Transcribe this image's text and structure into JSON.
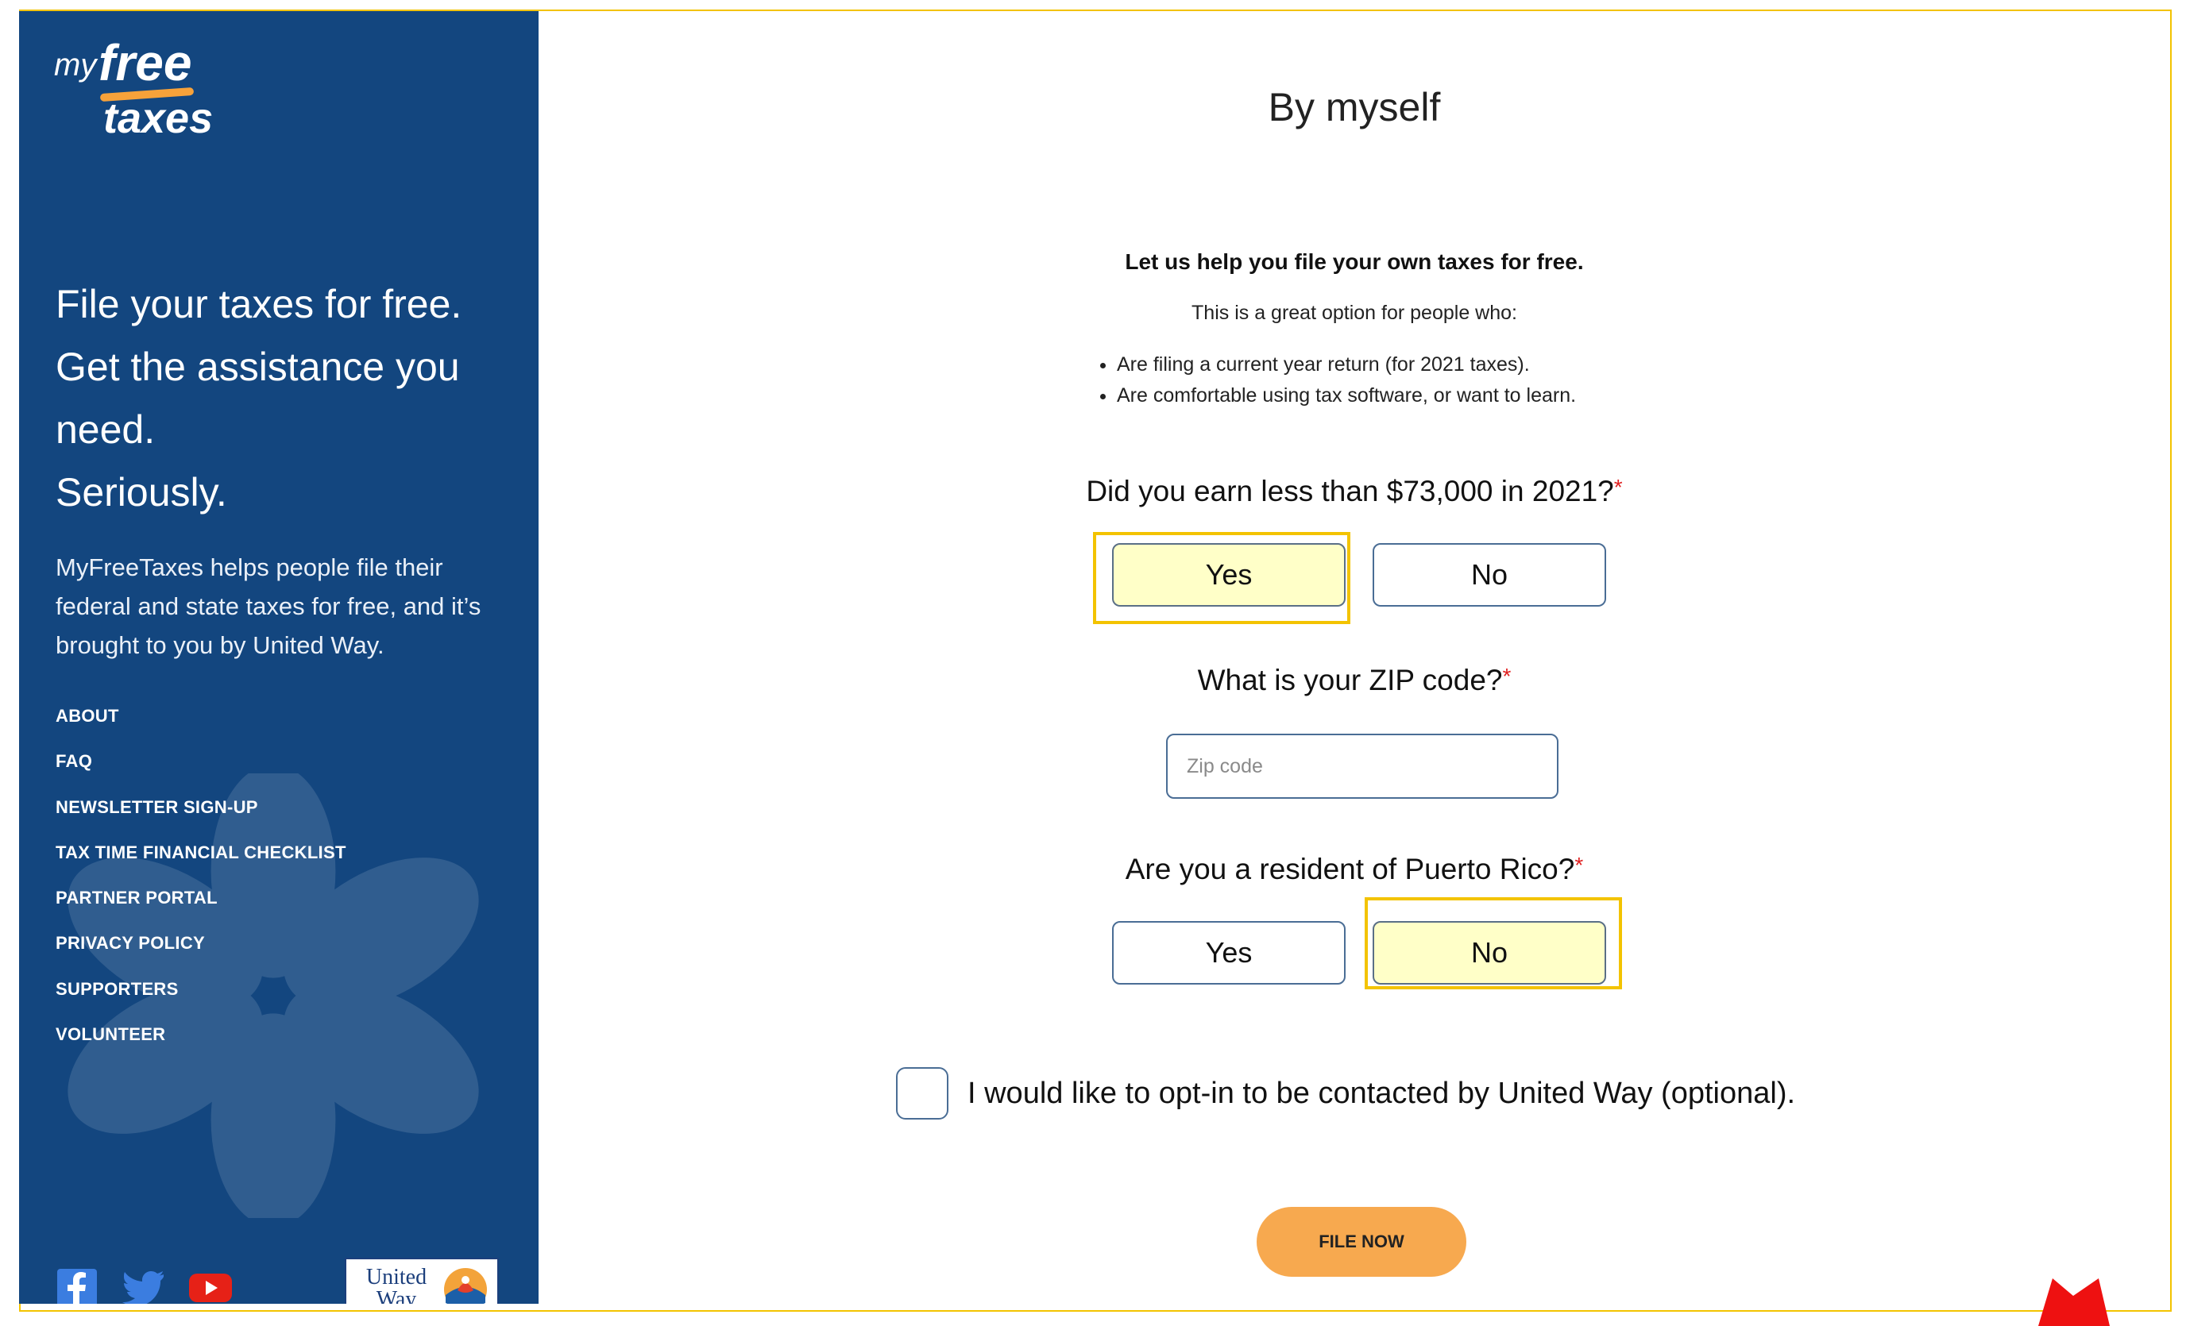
{
  "logo": {
    "my": "my",
    "free": "free",
    "taxes": "taxes"
  },
  "sidebar": {
    "tagline": [
      "File your taxes for free.",
      "Get the assistance you",
      "need.",
      "Seriously."
    ],
    "description": "MyFreeTaxes helps people file their federal and state taxes for free, and it’s brought to you by United Way.",
    "nav": [
      "ABOUT",
      "FAQ",
      "NEWSLETTER SIGN-UP",
      "TAX TIME FINANCIAL CHECKLIST",
      "PARTNER PORTAL",
      "PRIVACY POLICY",
      "SUPPORTERS",
      "VOLUNTEER"
    ],
    "social_icons": [
      "facebook-icon",
      "twitter-icon",
      "youtube-icon"
    ],
    "united_way": "United Way"
  },
  "main": {
    "title": "By myself",
    "intro_bold": "Let us help you file your own taxes for free.",
    "intro": "This is a great option for people who:",
    "bullets": [
      "Are filing a current year return (for 2021 taxes).",
      "Are comfortable using tax software, or want to learn."
    ],
    "q_income": {
      "label": "Did you earn less than $73,000 in 2021?",
      "required": "*",
      "yes": "Yes",
      "no": "No",
      "selected": "Yes"
    },
    "q_zip": {
      "label": "What is your ZIP code?",
      "required": "*",
      "placeholder": "Zip code",
      "value": ""
    },
    "q_pr": {
      "label": "Are you a resident of Puerto Rico?",
      "required": "*",
      "yes": "Yes",
      "no": "No",
      "selected": "No"
    },
    "opt_in": {
      "label": "I would like to opt-in to be contacted by United Way (optional).",
      "checked": false
    },
    "file_now": "FILE NOW"
  },
  "colors": {
    "sidebar": "#13467f",
    "accent_orange": "#f7a94f",
    "highlight": "#f3c300",
    "selected_fill": "#ffffc8",
    "required": "#e02020"
  }
}
